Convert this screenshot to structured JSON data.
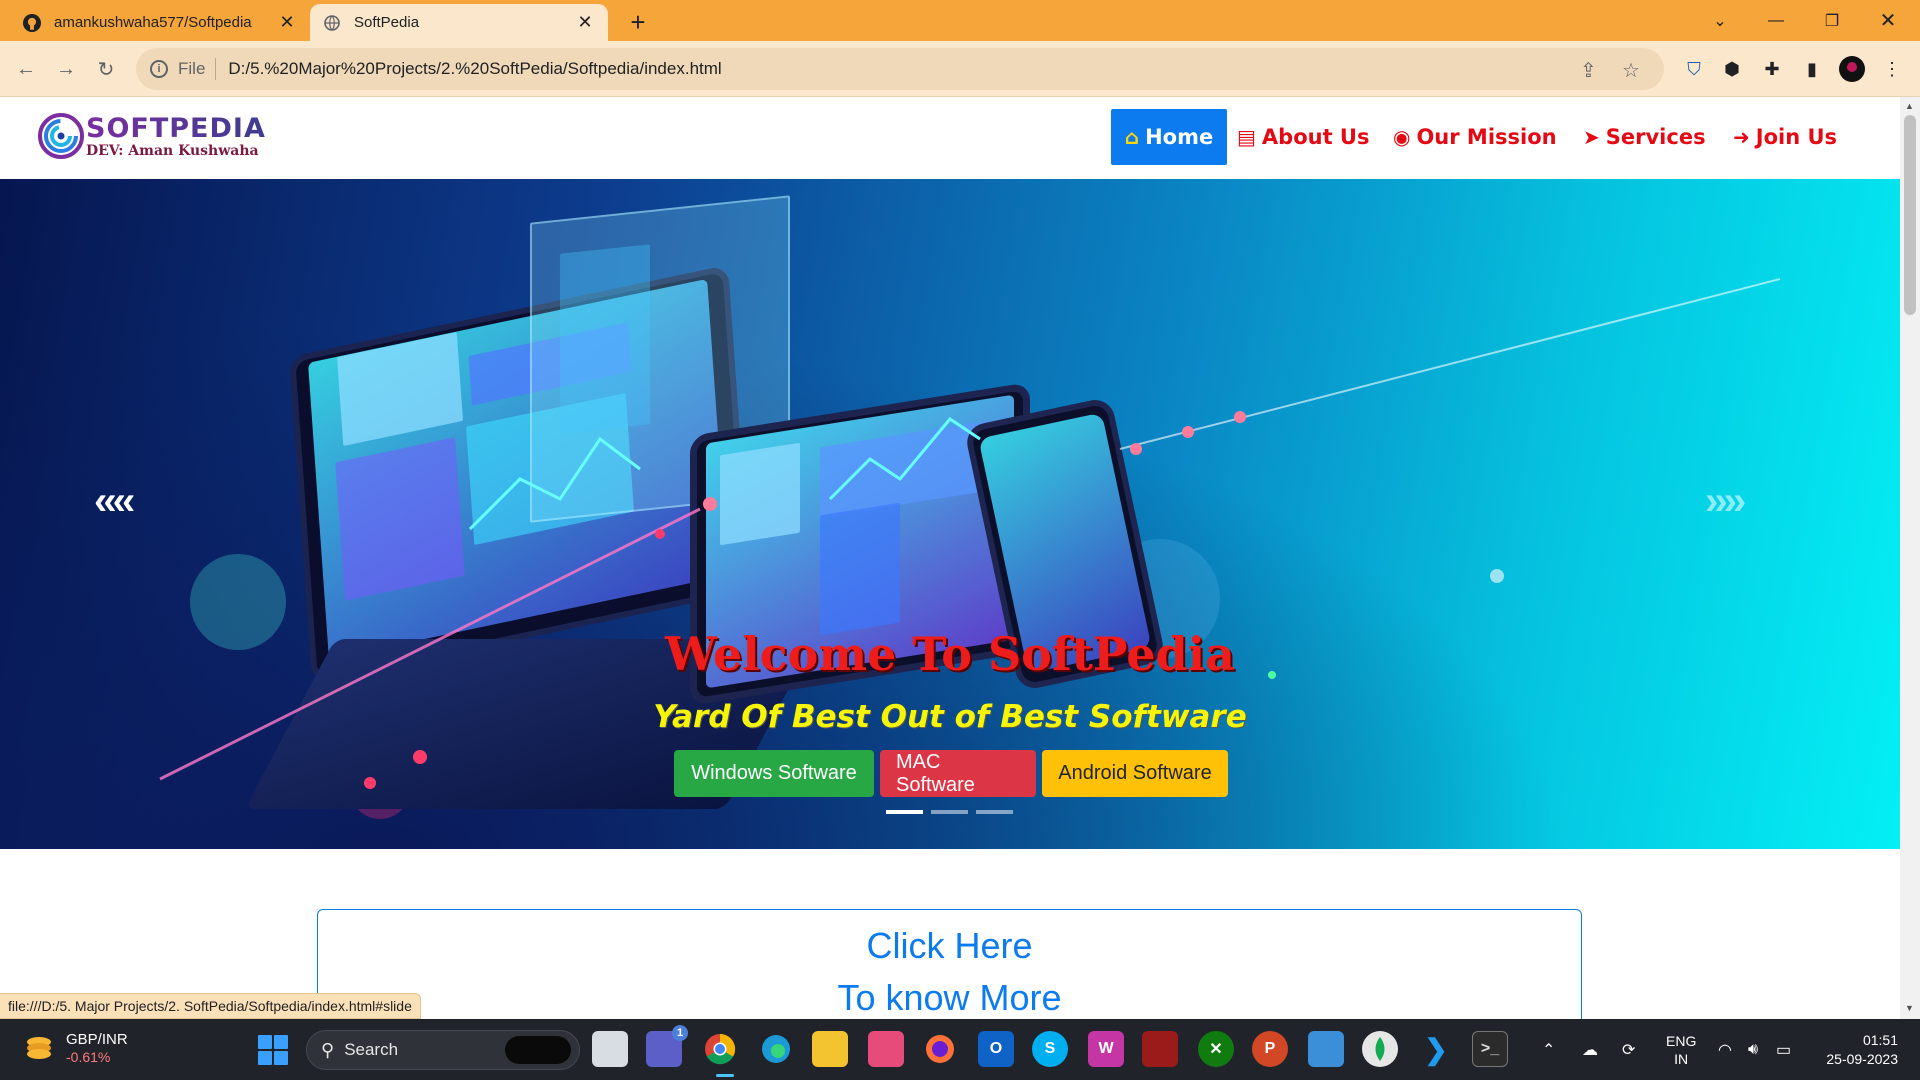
{
  "browser": {
    "tabs": [
      {
        "title": "amankushwaha577/Softpedia",
        "icon": "github-icon"
      },
      {
        "title": "SoftPedia",
        "icon": "globe-icon"
      }
    ],
    "address": {
      "scheme_label": "File",
      "url": "D:/5.%20Major%20Projects/2.%20SoftPedia/Softpedia/index.html"
    },
    "status_url": "file:///D:/5. Major Projects/2. SoftPedia/Softpedia/index.html#slide",
    "theme_color": "#f5a53a"
  },
  "site": {
    "logo": {
      "brand": "SOFTPEDIA",
      "dev": "DEV: Aman Kushwaha"
    },
    "nav": [
      {
        "label": "Home",
        "icon": "home-icon",
        "active": true
      },
      {
        "label": "About Us",
        "icon": "id-card-icon"
      },
      {
        "label": "Our Mission",
        "icon": "target-icon"
      },
      {
        "label": "Services",
        "icon": "pointer-icon"
      },
      {
        "label": "Join Us",
        "icon": "sign-in-icon"
      }
    ],
    "hero": {
      "title": "Welcome To SoftPedia",
      "subtitle": "Yard Of Best Out of Best Software",
      "buttons": [
        "Windows Software",
        "MAC Software",
        "Android Software"
      ],
      "prev_arrows": "‹‹‹‹",
      "next_arrows": "››››",
      "slides": 3,
      "active_slide": 1
    },
    "know_more": {
      "line1": "Click Here",
      "line2": "To know More"
    }
  },
  "taskbar": {
    "ticker": {
      "name": "GBP/INR",
      "change": "-0.61%"
    },
    "search_placeholder": "Search",
    "tray": {
      "lang1": "ENG",
      "lang2": "IN",
      "time": "01:51",
      "date": "25-09-2023"
    },
    "teams_badge": "1"
  }
}
